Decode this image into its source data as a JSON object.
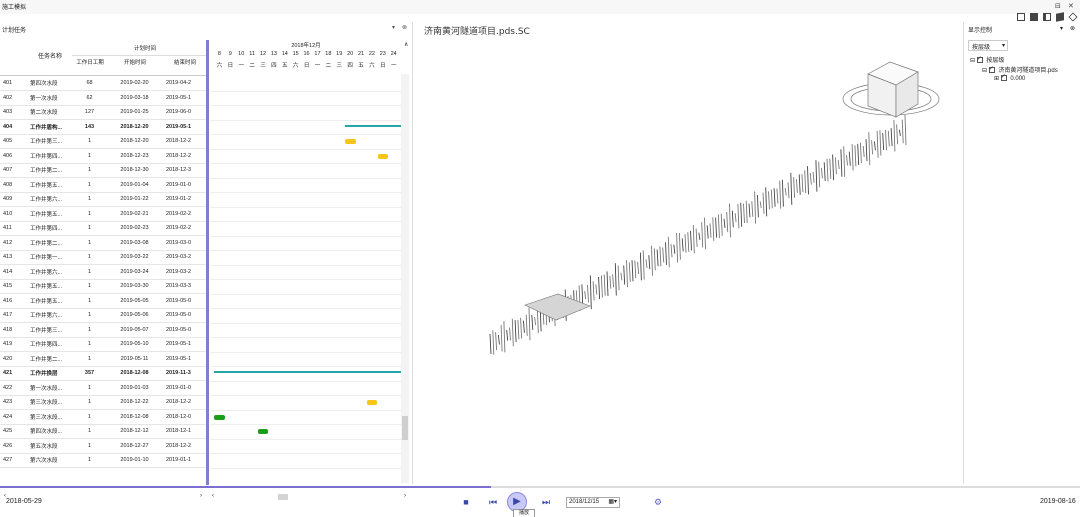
{
  "window": {
    "title": "施工模拟",
    "controls": [
      "⊟",
      "✕"
    ]
  },
  "left_panel": {
    "title": "计划任务",
    "pin": "▾",
    "close": "⊗",
    "headers": {
      "id": "",
      "name": "任务名称",
      "plan_time": "计划时间",
      "duration": "工作日工期",
      "start": "开始时间",
      "end": "结束时间"
    },
    "rows": [
      {
        "id": "401",
        "name": "第四次水段",
        "dur": "68",
        "start": "2019-02-20",
        "end": "2019-04-2"
      },
      {
        "id": "402",
        "name": "第一次水段",
        "dur": "62",
        "start": "2019-03-18",
        "end": "2019-05-1"
      },
      {
        "id": "403",
        "name": "第二次水段",
        "dur": "127",
        "start": "2019-01-25",
        "end": "2019-06-0"
      },
      {
        "id": "404",
        "name": "工作井盾构...",
        "dur": "143",
        "start": "2018-12-20",
        "end": "2019-05-1",
        "summary": true
      },
      {
        "id": "405",
        "name": "工作井第三...",
        "dur": "1",
        "start": "2018-12-20",
        "end": "2018-12-2"
      },
      {
        "id": "406",
        "name": "工作井第四...",
        "dur": "1",
        "start": "2018-12-23",
        "end": "2018-12-2"
      },
      {
        "id": "407",
        "name": "工作井第二...",
        "dur": "1",
        "start": "2018-12-30",
        "end": "2018-12-3"
      },
      {
        "id": "408",
        "name": "工作井第五...",
        "dur": "1",
        "start": "2019-01-04",
        "end": "2019-01-0"
      },
      {
        "id": "409",
        "name": "工作井第六...",
        "dur": "1",
        "start": "2019-01-22",
        "end": "2019-01-2"
      },
      {
        "id": "410",
        "name": "工作井第五...",
        "dur": "1",
        "start": "2019-02-21",
        "end": "2019-02-2"
      },
      {
        "id": "411",
        "name": "工作井第四...",
        "dur": "1",
        "start": "2019-02-23",
        "end": "2019-02-2"
      },
      {
        "id": "412",
        "name": "工作井第二...",
        "dur": "1",
        "start": "2019-03-08",
        "end": "2019-03-0"
      },
      {
        "id": "413",
        "name": "工作井第一...",
        "dur": "1",
        "start": "2019-03-22",
        "end": "2019-03-2"
      },
      {
        "id": "414",
        "name": "工作井第六...",
        "dur": "1",
        "start": "2019-03-24",
        "end": "2019-03-2"
      },
      {
        "id": "415",
        "name": "工作井第五...",
        "dur": "1",
        "start": "2019-03-30",
        "end": "2019-03-3"
      },
      {
        "id": "416",
        "name": "工作井第五...",
        "dur": "1",
        "start": "2019-05-05",
        "end": "2019-05-0"
      },
      {
        "id": "417",
        "name": "工作井第六...",
        "dur": "1",
        "start": "2019-05-06",
        "end": "2019-05-0"
      },
      {
        "id": "418",
        "name": "工作井第三...",
        "dur": "1",
        "start": "2019-05-07",
        "end": "2019-05-0"
      },
      {
        "id": "419",
        "name": "工作井第四...",
        "dur": "1",
        "start": "2019-05-10",
        "end": "2019-05-1"
      },
      {
        "id": "420",
        "name": "工作井第二...",
        "dur": "1",
        "start": "2019-05-11",
        "end": "2019-05-1"
      },
      {
        "id": "421",
        "name": "工作井换层",
        "dur": "357",
        "start": "2018-12-08",
        "end": "2019-11-3",
        "summary": true
      },
      {
        "id": "422",
        "name": "第一次水段...",
        "dur": "1",
        "start": "2019-01-03",
        "end": "2019-01-0"
      },
      {
        "id": "423",
        "name": "第三次水段...",
        "dur": "1",
        "start": "2018-12-22",
        "end": "2018-12-2"
      },
      {
        "id": "424",
        "name": "第三次水段...",
        "dur": "1",
        "start": "2018-12-08",
        "end": "2018-12-0"
      },
      {
        "id": "425",
        "name": "第四次水段...",
        "dur": "1",
        "start": "2018-12-12",
        "end": "2018-12-1"
      },
      {
        "id": "426",
        "name": "第五次水段",
        "dur": "1",
        "start": "2018-12-27",
        "end": "2018-12-2"
      },
      {
        "id": "427",
        "name": "第六次水段",
        "dur": "1",
        "start": "2019-01-10",
        "end": "2019-01-1"
      }
    ]
  },
  "gantt": {
    "month": "2018年12月",
    "days": [
      "8",
      "9",
      "10",
      "11",
      "12",
      "13",
      "14",
      "15",
      "16",
      "17",
      "18",
      "19",
      "20",
      "21",
      "22",
      "23",
      "24"
    ],
    "weekdays": [
      "六",
      "日",
      "一",
      "二",
      "三",
      "四",
      "五",
      "六",
      "日",
      "一",
      "二",
      "三",
      "四",
      "五",
      "六",
      "日",
      "一"
    ],
    "colors": {
      "summary": "#26a6a8",
      "pending": "#f5c518",
      "active": "#1a9e1a"
    }
  },
  "view3d": {
    "title": "济南黄河隧道项目.pds.SC"
  },
  "right_panel": {
    "title": "显示控制",
    "pin": "▾",
    "close": "⊗",
    "mode": "按层级",
    "tree": [
      {
        "label": "按层级"
      },
      {
        "label": "济南黄河隧道项目.pds"
      },
      {
        "label": "0.000"
      }
    ]
  },
  "bottom": {
    "start_date": "2018-05-29",
    "end_date": "2019-08-16",
    "current_date": "2018/12/15",
    "tooltip": "播放",
    "progress": 0.455
  }
}
